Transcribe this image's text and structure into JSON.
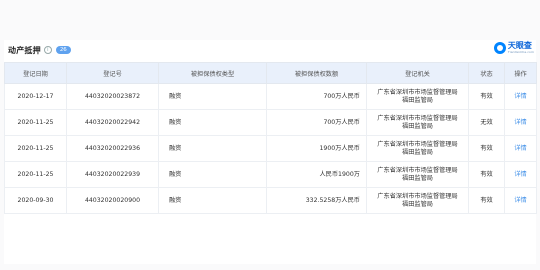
{
  "section": {
    "title": "动产抵押",
    "info_icon": "i",
    "count": "26"
  },
  "logo": {
    "name": "天眼查",
    "sub": "TianYanCha.com"
  },
  "table": {
    "columns": [
      "登记日期",
      "登记号",
      "被担保债权类型",
      "被担保债权数额",
      "登记机关",
      "状态",
      "操作"
    ],
    "rows": [
      {
        "date": "2020-12-17",
        "reg_no": "44032020023872",
        "type": "融资",
        "amount": "700万人民币",
        "authority_line1": "广东省深圳市市场监督管理局",
        "authority_line2": "福田监管局",
        "status": "有效",
        "action": "详情"
      },
      {
        "date": "2020-11-25",
        "reg_no": "44032020022942",
        "type": "融资",
        "amount": "700万人民币",
        "authority_line1": "广东省深圳市市场监督管理局",
        "authority_line2": "福田监管局",
        "status": "无效",
        "action": "详情"
      },
      {
        "date": "2020-11-25",
        "reg_no": "44032020022936",
        "type": "融资",
        "amount": "1900万人民币",
        "authority_line1": "广东省深圳市市场监督管理局",
        "authority_line2": "福田监管局",
        "status": "有效",
        "action": "详情"
      },
      {
        "date": "2020-11-25",
        "reg_no": "44032020022939",
        "type": "融资",
        "amount": "人民币1900万",
        "authority_line1": "广东省深圳市市场监督管理局",
        "authority_line2": "福田监管局",
        "status": "有效",
        "action": "详情"
      },
      {
        "date": "2020-09-30",
        "reg_no": "44032020020900",
        "type": "融资",
        "amount": "332.5258万人民币",
        "authority_line1": "广东省深圳市市场监督管理局",
        "authority_line2": "福田监管局",
        "status": "有效",
        "action": "详情"
      }
    ]
  }
}
